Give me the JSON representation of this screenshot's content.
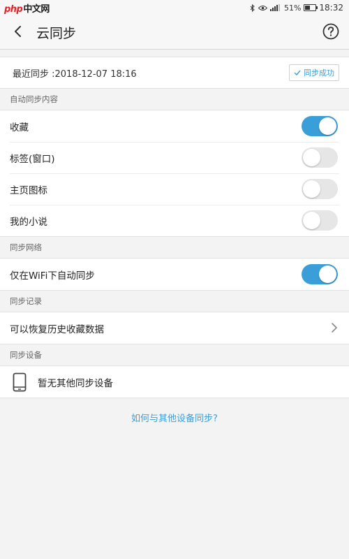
{
  "statusbar": {
    "watermark_latin": "php",
    "watermark_cn": "中文网",
    "battery_percent": "51%",
    "battery_level": 0.51,
    "time": "18:32",
    "icons": [
      "bluetooth-icon",
      "eye-icon",
      "signal-icon",
      "battery-icon"
    ]
  },
  "header": {
    "title": "云同步",
    "back_icon": "chevron-left-icon",
    "help_icon": "question-circle-icon"
  },
  "last_sync": {
    "label": "最近同步 :2018-12-07 18:16",
    "status": "同步成功",
    "status_icon": "check-icon"
  },
  "sections": {
    "auto_sync_content": {
      "header": "自动同步内容",
      "items": [
        {
          "label": "收藏",
          "enabled": true
        },
        {
          "label": "标签(窗口)",
          "enabled": false
        },
        {
          "label": "主页图标",
          "enabled": false
        },
        {
          "label": "我的小说",
          "enabled": false
        }
      ]
    },
    "sync_network": {
      "header": "同步网络",
      "items": [
        {
          "label": "仅在WiFi下自动同步",
          "enabled": true
        }
      ]
    },
    "sync_records": {
      "header": "同步记录",
      "items": [
        {
          "label": "可以恢复历史收藏数据"
        }
      ]
    },
    "sync_devices": {
      "header": "同步设备",
      "items": [
        {
          "label": "暂无其他同步设备",
          "icon": "phone-icon"
        }
      ]
    }
  },
  "footer": {
    "howto_link": "如何与其他设备同步?"
  },
  "colors": {
    "accent": "#3a9fd8",
    "toggle_off": "#e6e6e6",
    "background": "#f3f3f3"
  }
}
